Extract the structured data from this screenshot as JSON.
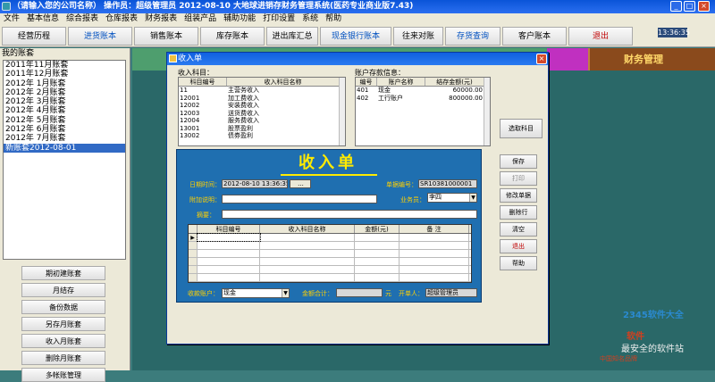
{
  "window": {
    "title": "（请输入您的公司名称）  操作员：超级管理员  2012-08-10  大地球进销存财务管理系统(医药专业商业版7.43)",
    "clock": "13:36:35"
  },
  "menu": [
    "文件",
    "基本信息",
    "综合报表",
    "仓库报表",
    "财务报表",
    "组装产品",
    "辅助功能",
    "打印设置",
    "系统",
    "帮助"
  ],
  "toolbar": [
    {
      "label": "经营历程",
      "tone": "normal"
    },
    {
      "label": "进货账本",
      "tone": "blue"
    },
    {
      "label": "销售账本",
      "tone": "normal"
    },
    {
      "label": "库存账本",
      "tone": "normal"
    },
    {
      "label": "进出库汇总",
      "tone": "normal"
    },
    {
      "label": "现金银行账本",
      "tone": "blue"
    },
    {
      "label": "往来对账",
      "tone": "normal"
    },
    {
      "label": "存货查询",
      "tone": "blue"
    },
    {
      "label": "客户账本",
      "tone": "normal"
    },
    {
      "label": "退出",
      "tone": "red"
    }
  ],
  "left_panel": {
    "header": "我的账套",
    "accounts": [
      "2011年11月账套",
      "2011年12月账套",
      "2012年 1月账套",
      "2012年 2月账套",
      "2012年 3月账套",
      "2012年 4月账套",
      "2012年 5月账套",
      "2012年 6月账套",
      "2012年 7月账套",
      "新账套2012-08-01"
    ],
    "selected_index": 9,
    "buttons": [
      "期初建账套",
      "月结存",
      "备份数据",
      "另存月账套",
      "收入月账套",
      "删除月账套",
      "多帐账管理"
    ]
  },
  "finance_box": "财务管理",
  "dialog": {
    "title": "收入单",
    "subject_label": "收入科目：",
    "subject_columns": [
      "科目编号",
      "收入科目名称"
    ],
    "subjects": [
      {
        "code": "11",
        "name": "主营务收入"
      },
      {
        "code": "12001",
        "name": "加工费收入"
      },
      {
        "code": "12002",
        "name": "安装费收入"
      },
      {
        "code": "12003",
        "name": "送货费收入"
      },
      {
        "code": "12004",
        "name": "服务费收入"
      },
      {
        "code": "13001",
        "name": "股票盈利"
      },
      {
        "code": "13002",
        "name": "债券盈利"
      }
    ],
    "account_label": "账户存款信息：",
    "account_columns": [
      "编号",
      "账户名称",
      "结存金额(元)"
    ],
    "accounts": [
      {
        "code": "401",
        "name": "现金",
        "balance": "60000.00"
      },
      {
        "code": "402",
        "name": "工行账户",
        "balance": "800000.00"
      }
    ],
    "select_subject_button": "选取科目",
    "form": {
      "heading": "收入单",
      "date_label": "日期时间：",
      "date_value": "2012-08-10 13:36:35",
      "doc_no_label": "单据编号：",
      "doc_no_value": "SR10381000001",
      "note_label": "附加说明：",
      "note_value": "",
      "salesman_label": "业务员：",
      "salesman_value": "李四",
      "summary_label": "摘要：",
      "summary_value": "",
      "grid_columns": [
        "科目编号",
        "收入科目名称",
        "金额(元)",
        "备  注"
      ],
      "pay_account_label": "收款账户：",
      "pay_account_value": "现金",
      "total_label": "金额合计：",
      "total_value": "",
      "total_unit": "元",
      "maker_label": "开单人：",
      "maker_value": "超级管理员"
    },
    "buttons": [
      "保存",
      "打印",
      "修改单据",
      "删除行",
      "清空",
      "退出",
      "帮助"
    ]
  },
  "watermark": {
    "brand": "2345软件大全",
    "line1": "软件",
    "line2": "最安全的软件站",
    "line3": "中国知名品牌"
  }
}
